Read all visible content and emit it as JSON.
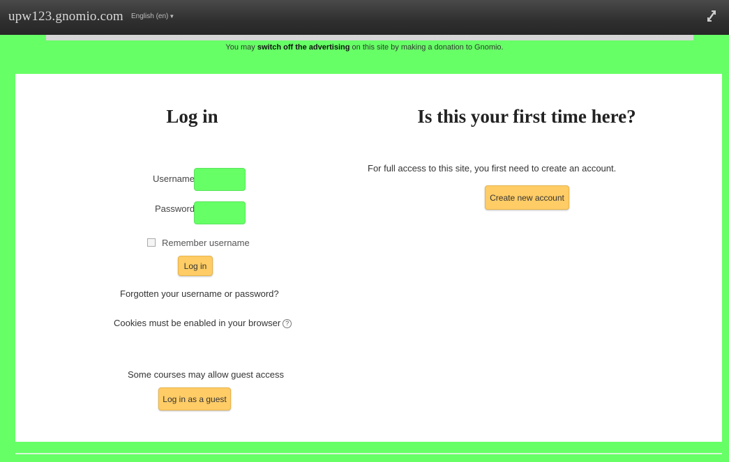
{
  "header": {
    "site_name": "upw123.gnomio.com",
    "language": "English (en)"
  },
  "ad_banner": {
    "prefix": "You may ",
    "link": "switch off the advertising",
    "suffix": " on this site by making a donation to Gnomio."
  },
  "login": {
    "title": "Log in",
    "username_label": "Username",
    "username_value": "",
    "password_label": "Password",
    "password_value": "",
    "remember_label": "Remember username",
    "remember_checked": false,
    "login_button": "Log in",
    "forgot_link": "Forgotten your username or password?",
    "cookies_text": "Cookies must be enabled in your browser",
    "help_icon": "?",
    "guest_text": "Some courses may allow guest access",
    "guest_button": "Log in as a guest"
  },
  "signup": {
    "title": "Is this your first time here?",
    "text": "For full access to this site, you first need to create an account.",
    "create_button": "Create new account"
  },
  "colors": {
    "page_green": "#66ff66",
    "button": "#ffcc66",
    "topbar": "#2f2f2f"
  }
}
